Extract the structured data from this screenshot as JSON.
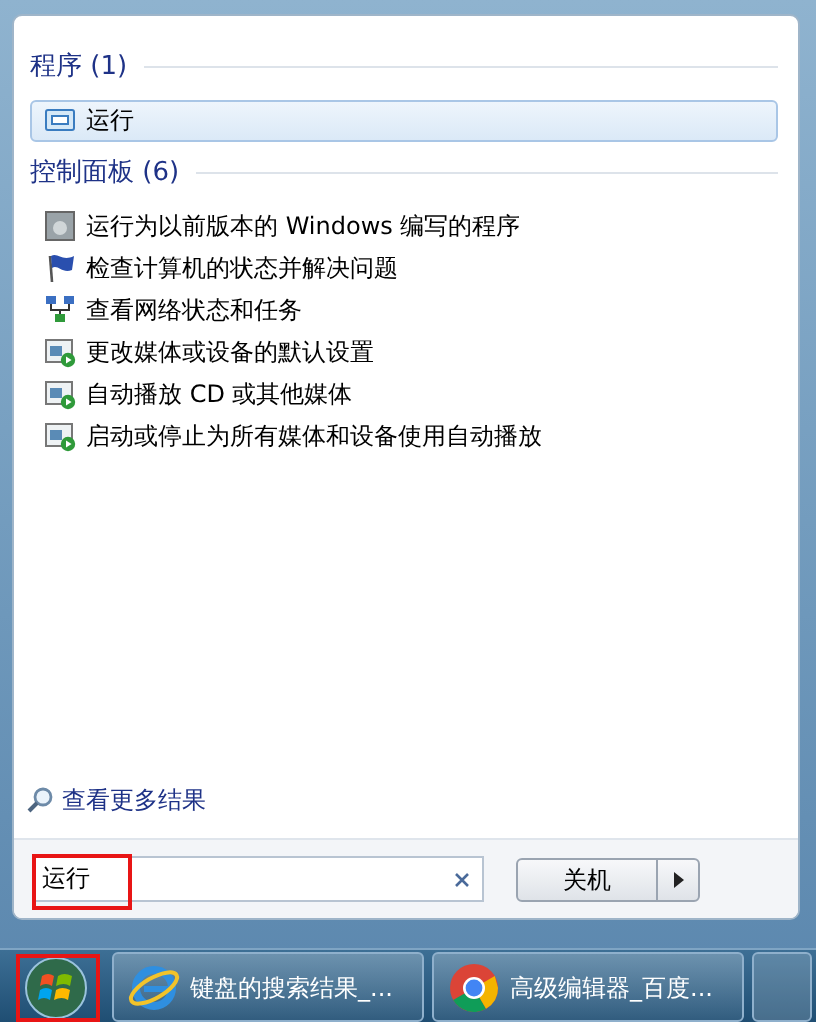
{
  "groups": [
    {
      "title": "程序 (1)",
      "items": [
        {
          "label": "运行",
          "kind": "run",
          "selected": true
        }
      ]
    },
    {
      "title": "控制面板 (6)",
      "items": [
        {
          "label": "运行为以前版本的 Windows 编写的程序",
          "kind": "compat",
          "selected": false
        },
        {
          "label": "检查计算机的状态并解决问题",
          "kind": "flag",
          "selected": false
        },
        {
          "label": "查看网络状态和任务",
          "kind": "network",
          "selected": false
        },
        {
          "label": "更改媒体或设备的默认设置",
          "kind": "media",
          "selected": false
        },
        {
          "label": "自动播放 CD 或其他媒体",
          "kind": "media",
          "selected": false
        },
        {
          "label": "启动或停止为所有媒体和设备使用自动播放",
          "kind": "media",
          "selected": false
        }
      ]
    }
  ],
  "more_results": "查看更多结果",
  "search": {
    "value": "运行",
    "highlighted": true
  },
  "shutdown_button": "关机",
  "taskbar": {
    "start_highlighted": true,
    "tasks": [
      {
        "label": "键盘的搜索结果_...",
        "kind": "ie"
      },
      {
        "label": "高级编辑器_百度...",
        "kind": "chrome"
      }
    ]
  }
}
